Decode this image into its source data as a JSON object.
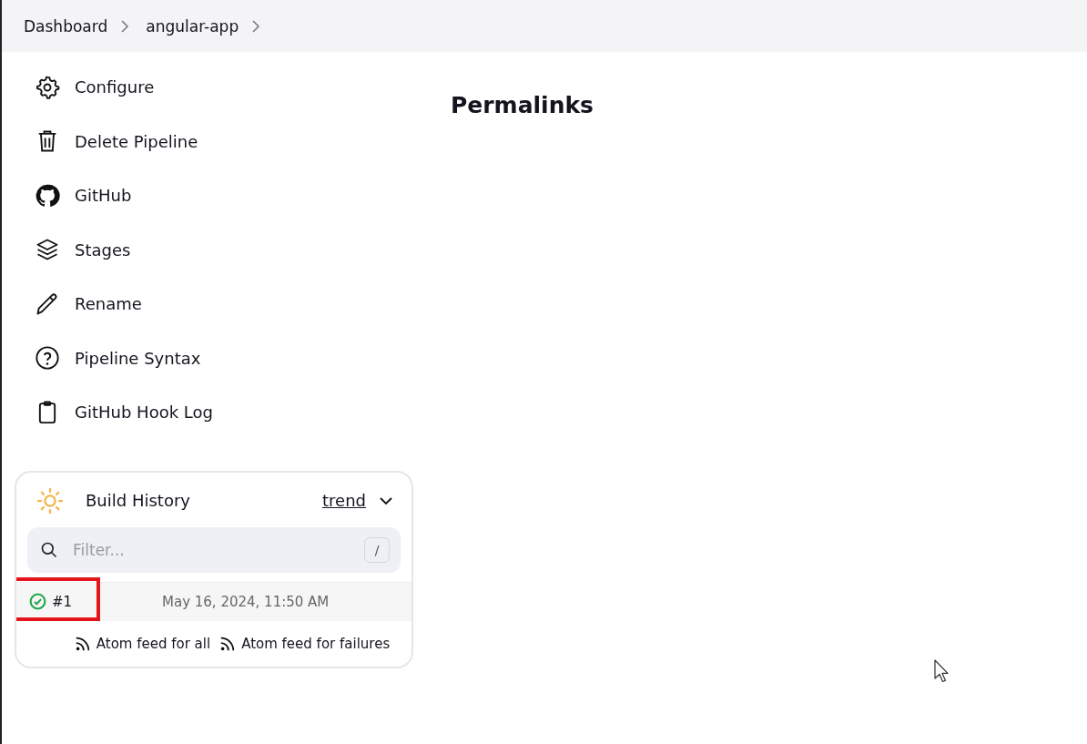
{
  "breadcrumbs": [
    {
      "label": "Dashboard"
    },
    {
      "label": "angular-app"
    }
  ],
  "sidebar": {
    "items": [
      {
        "label": "Configure",
        "kind": "gear"
      },
      {
        "label": "Delete Pipeline",
        "kind": "trash"
      },
      {
        "label": "GitHub",
        "kind": "github"
      },
      {
        "label": "Stages",
        "kind": "layers"
      },
      {
        "label": "Rename",
        "kind": "pencil"
      },
      {
        "label": "Pipeline Syntax",
        "kind": "help"
      },
      {
        "label": "GitHub Hook Log",
        "kind": "clipboard"
      }
    ]
  },
  "heading": "Permalinks",
  "build_history": {
    "title": "Build History",
    "trend": "trend",
    "filter": {
      "placeholder": "Filter...",
      "shortcut": "/"
    },
    "builds": [
      {
        "number": "#1",
        "date": "May 16, 2024, 11:50 AM",
        "color": "#1ea64b",
        "highlighted": true
      }
    ],
    "feeds": [
      {
        "label": "Atom feed for all"
      },
      {
        "label": "Atom feed for failures"
      }
    ]
  }
}
